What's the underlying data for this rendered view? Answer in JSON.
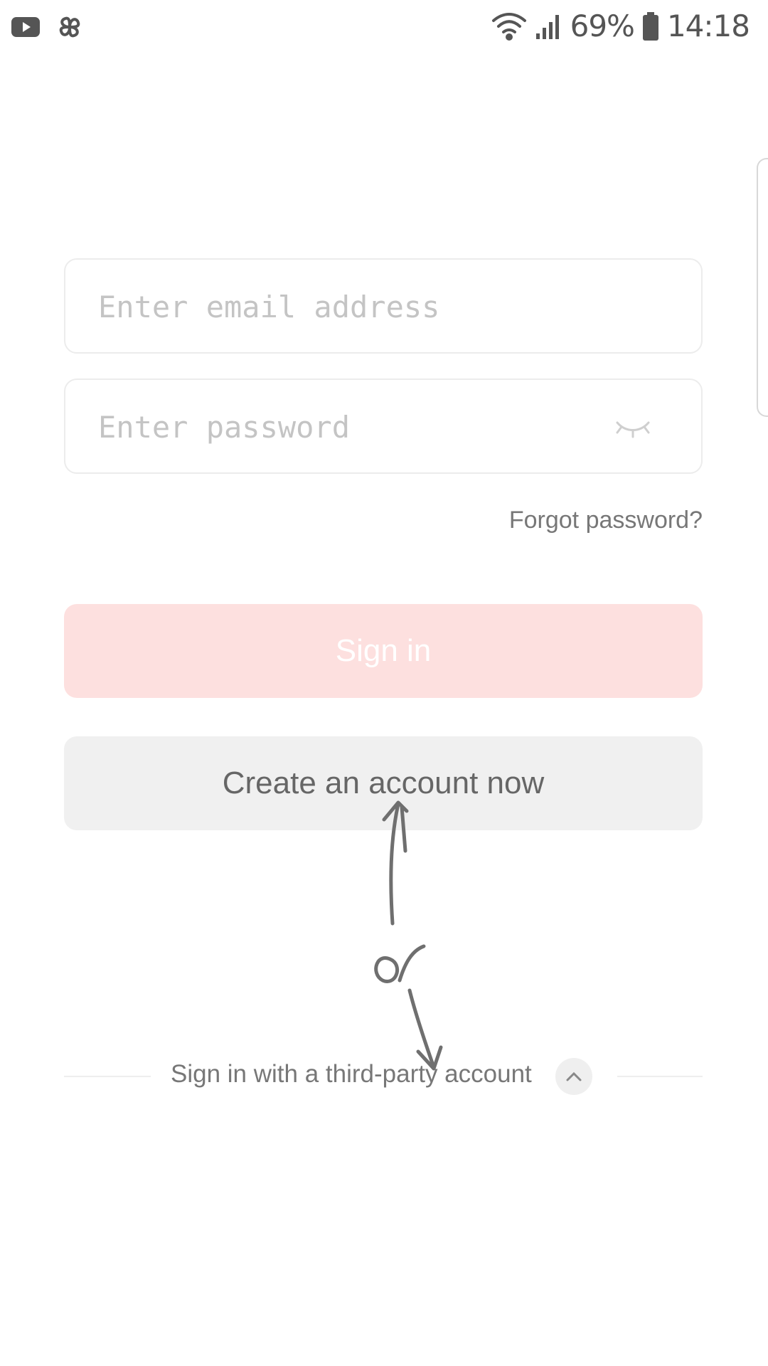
{
  "status_bar": {
    "battery_percent": "69%",
    "time": "14:18",
    "icons": [
      "youtube-icon",
      "pinwheel-icon",
      "wifi-icon",
      "signal-icon",
      "battery-icon"
    ]
  },
  "form": {
    "email_placeholder": "Enter email address",
    "password_placeholder": "Enter password",
    "forgot_label": "Forgot password?"
  },
  "buttons": {
    "sign_in": "Sign in",
    "create_account": "Create an account now"
  },
  "third_party": {
    "label": "Sign in with a third-party account"
  },
  "annotation": {
    "text": "or"
  },
  "colors": {
    "sign_in_bg": "#fde0df",
    "create_bg": "#f0f0f0"
  }
}
